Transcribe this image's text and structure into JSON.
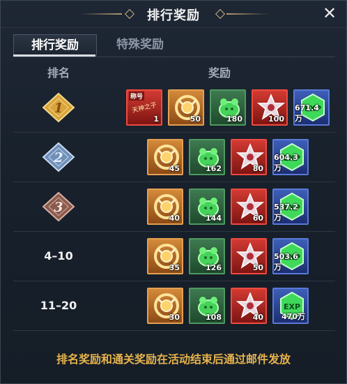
{
  "window": {
    "title": "排行奖励",
    "close_icon": "close-icon"
  },
  "tabs": [
    {
      "label": "排行奖励",
      "active": true
    },
    {
      "label": "特殊奖励",
      "active": false
    }
  ],
  "header": {
    "rank": "排名",
    "reward": "奖励"
  },
  "rows": [
    {
      "rank": "1",
      "rank_style": "gold-diamond-badge",
      "items": [
        {
          "type": "title",
          "color": "red",
          "badge": "称号",
          "caption": "天神之子",
          "qty": "1"
        },
        {
          "type": "golden-ring",
          "color": "orange",
          "qty": "50"
        },
        {
          "type": "green-potion",
          "color": "green",
          "qty": "180"
        },
        {
          "type": "star-gem",
          "color": "red",
          "qty": "100"
        },
        {
          "type": "exp-gem",
          "color": "blue",
          "label": "EXP",
          "qty": "671.4万"
        }
      ]
    },
    {
      "rank": "2",
      "rank_style": "silver-diamond-badge",
      "items": [
        {
          "type": "golden-ring",
          "color": "orange",
          "qty": "45"
        },
        {
          "type": "green-potion",
          "color": "green",
          "qty": "162"
        },
        {
          "type": "star-gem",
          "color": "red",
          "qty": "80"
        },
        {
          "type": "exp-gem",
          "color": "blue",
          "label": "EXP",
          "qty": "604.3万"
        }
      ]
    },
    {
      "rank": "3",
      "rank_style": "bronze-diamond-badge",
      "items": [
        {
          "type": "golden-ring",
          "color": "orange",
          "qty": "40"
        },
        {
          "type": "green-potion",
          "color": "green",
          "qty": "144"
        },
        {
          "type": "star-gem",
          "color": "red",
          "qty": "60"
        },
        {
          "type": "exp-gem",
          "color": "blue",
          "label": "EXP",
          "qty": "537.2万"
        }
      ]
    },
    {
      "rank": "4–10",
      "items": [
        {
          "type": "golden-ring",
          "color": "orange",
          "qty": "35"
        },
        {
          "type": "green-potion",
          "color": "green",
          "qty": "126"
        },
        {
          "type": "star-gem",
          "color": "red",
          "qty": "50"
        },
        {
          "type": "exp-gem",
          "color": "blue",
          "label": "EXP",
          "qty": "503.6万"
        }
      ]
    },
    {
      "rank": "11–20",
      "items": [
        {
          "type": "golden-ring",
          "color": "orange",
          "qty": "30"
        },
        {
          "type": "green-potion",
          "color": "green",
          "qty": "108"
        },
        {
          "type": "star-gem",
          "color": "red",
          "qty": "40"
        },
        {
          "type": "exp-gem",
          "color": "blue",
          "label": "EXP",
          "qty": "470万"
        }
      ]
    },
    {
      "rank": "",
      "items": [
        {
          "type": "golden-ring",
          "color": "orange",
          "qty": ""
        },
        {
          "type": "green-potion",
          "color": "green",
          "qty": ""
        },
        {
          "type": "star-gem",
          "color": "red",
          "qty": ""
        },
        {
          "type": "exp-gem",
          "color": "blue",
          "label": "",
          "qty": ""
        }
      ]
    }
  ],
  "footer": {
    "notice": "排名奖励和通关奖励在活动结束后通过邮件发放"
  },
  "colors": {
    "notice": "#e7b34c",
    "accent_gold": "#d9a845",
    "panel_bg": "#18212c"
  }
}
